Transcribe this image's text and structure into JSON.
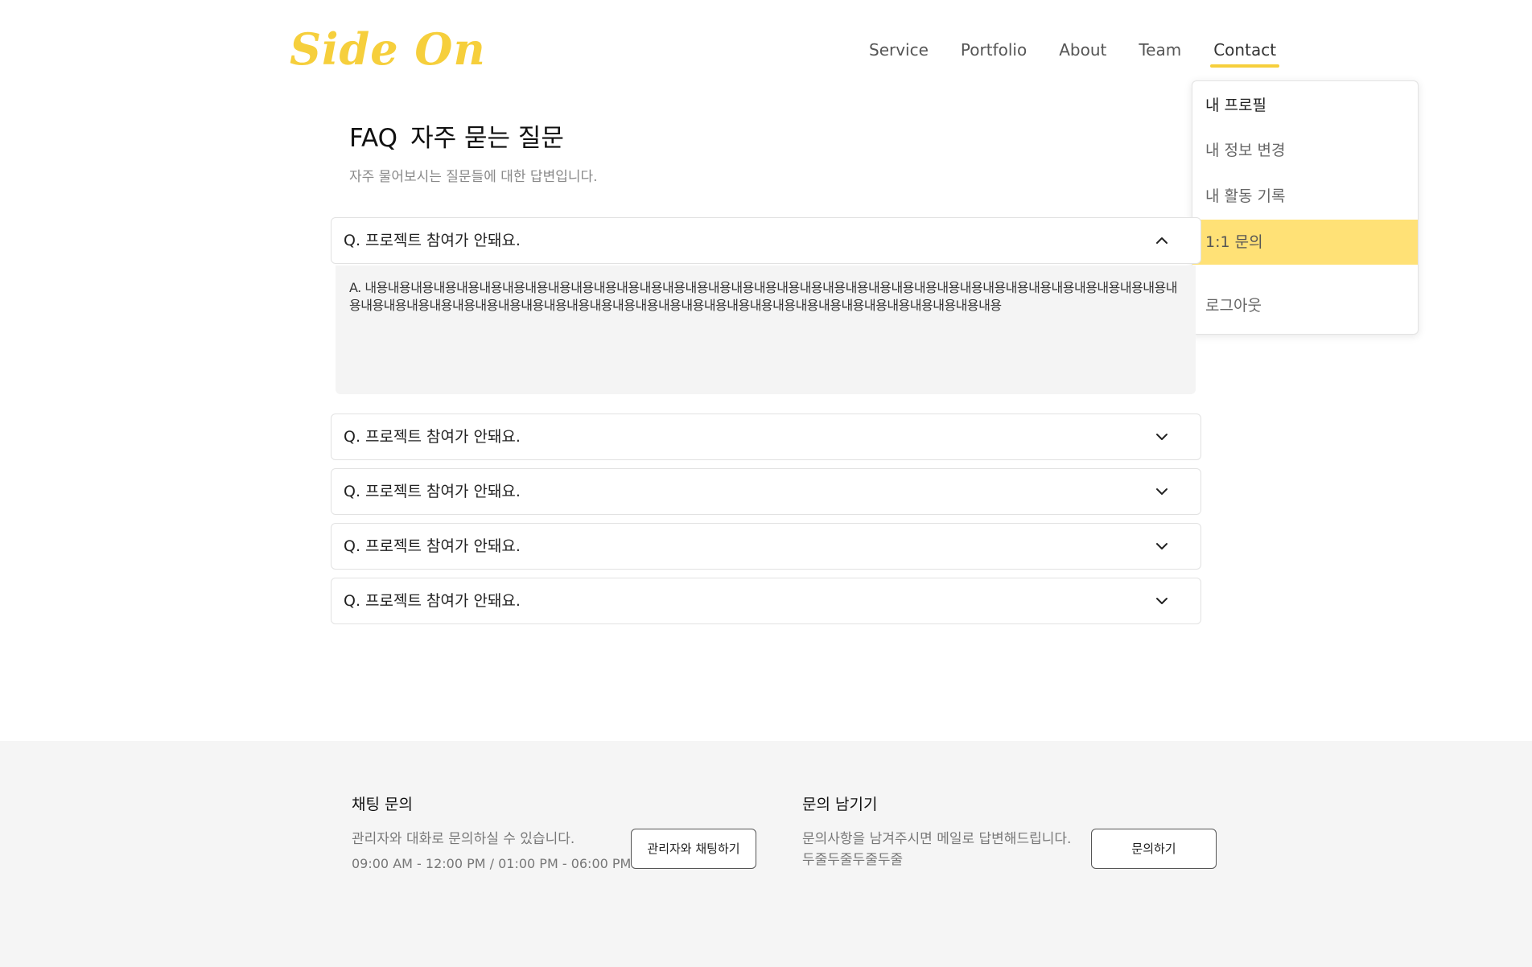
{
  "header": {
    "logo": "Side On",
    "nav": [
      "Service",
      "Portfolio",
      "About",
      "Team",
      "Contact"
    ],
    "active_nav": "Contact"
  },
  "dropdown": {
    "items": [
      "내 프로필",
      "내 정보 변경",
      "내 활동 기록",
      "1:1 문의",
      "로그아웃"
    ],
    "active_item": "1:1 문의"
  },
  "faq": {
    "title": "FAQ",
    "title_ko": "자주 묻는 질문",
    "subtitle": "자주 물어보시는 질문들에 대한 답변입니다.",
    "items": [
      {
        "question": "Q. 프로젝트 참여가 안돼요.",
        "expanded": true,
        "answer": "A. 내용내용내용내용내용내용내용내용내용내용내용내용내용내용내용내용내용내용내용내용내용내용내용내용내용내용내용내용내용내용내용내용내용내용내용내용내용내용내용내용내용내용내용내용내용내용내용내용내용내용내용내용내용내용내용내용내용내용내용내용내용내용내용내용"
      },
      {
        "question": "Q. 프로젝트 참여가 안돼요.",
        "expanded": false
      },
      {
        "question": "Q. 프로젝트 참여가 안돼요.",
        "expanded": false
      },
      {
        "question": "Q. 프로젝트 참여가 안돼요.",
        "expanded": false
      },
      {
        "question": "Q. 프로젝트 참여가 안돼요.",
        "expanded": false
      }
    ]
  },
  "footer": {
    "chat": {
      "title": "채팅 문의",
      "desc": "관리자와 대화로 문의하실 수 있습니다.",
      "hours": "09:00 AM - 12:00 PM  / 01:00 PM - 06:00 PM",
      "button": "관리자와 채팅하기"
    },
    "inquiry": {
      "title": "문의 남기기",
      "desc": "문의사항을 남겨주시면 메일로 답변해드립니다.",
      "extra": "두줄두줄두줄두줄",
      "button": "문의하기"
    }
  },
  "colors": {
    "accent": "#f6cf3c",
    "highlight": "#ffe176",
    "footer_bg": "#f5f5f5",
    "answer_bg": "#f4f4f4"
  },
  "icons": {
    "expanded": "chevron-up-icon",
    "collapsed": "chevron-down-icon"
  }
}
